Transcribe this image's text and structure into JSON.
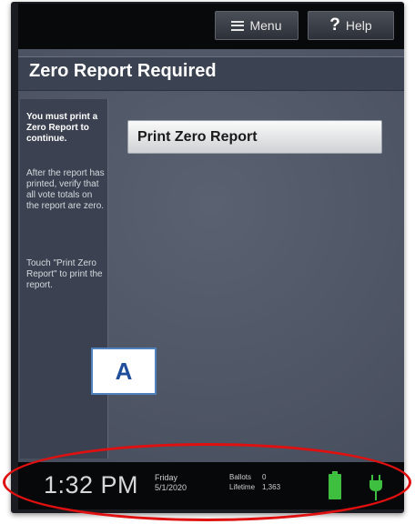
{
  "topbar": {
    "menu_label": "Menu",
    "help_label": "Help",
    "menu_icon": "hamburger-icon",
    "help_icon": "question-icon"
  },
  "title": "Zero Report Required",
  "sidebar": {
    "heading": "You must print a Zero Report to continue.",
    "body": "After the report has printed, verify that all vote totals on the report are zero.",
    "instruction": "Touch \"Print Zero Report\" to print the report."
  },
  "main": {
    "print_button_label": "Print Zero Report"
  },
  "annotation": {
    "label": "A"
  },
  "statusbar": {
    "time": "1:32 PM",
    "day": "Friday",
    "date": "5/1/2020",
    "ballots_label": "Ballots",
    "ballots_value": "0",
    "lifetime_label": "Lifetime",
    "lifetime_value": "1,363",
    "battery_icon": "battery-icon",
    "power_icon": "plug-icon"
  },
  "colors": {
    "battery": "#3fbf3f",
    "plug": "#3fbf3f",
    "highlight_ring": "#e01010",
    "callout_border": "#4f81bd"
  }
}
